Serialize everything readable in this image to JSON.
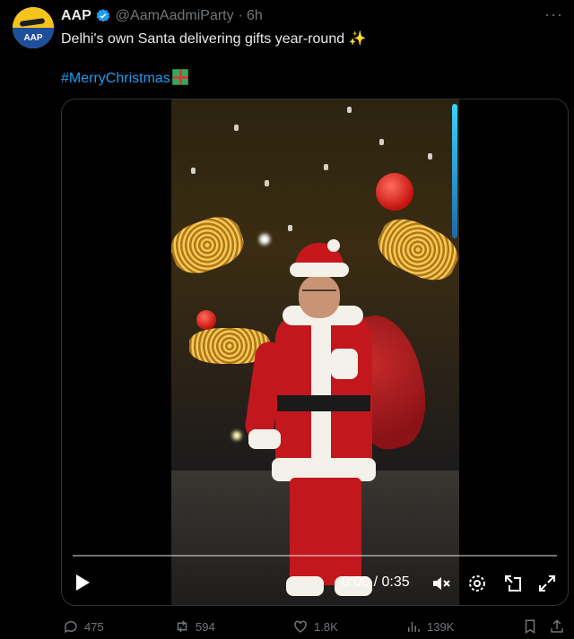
{
  "post": {
    "author_name": "AAP",
    "handle": "@AamAadmiParty",
    "separator": "·",
    "time": "6h",
    "avatar_text": "AAP",
    "more_label": "···",
    "text": "Delhi's own Santa delivering gifts year-round",
    "text_emoji": "✨",
    "hashtag": "#MerryChristmas",
    "hashtag_emoji_icon": "gift-icon"
  },
  "video": {
    "current_time": "0:00",
    "duration": "0:35",
    "time_separator": "/",
    "progress": 0,
    "icons": [
      "play-icon",
      "mute-icon",
      "settings-icon",
      "popout-icon",
      "fullscreen-icon"
    ]
  },
  "actions": {
    "replies": "475",
    "reposts": "594",
    "likes": "1.8K",
    "views": "139K",
    "icons": [
      "reply-icon",
      "repost-icon",
      "like-icon",
      "views-icon",
      "bookmark-icon",
      "share-icon"
    ]
  },
  "colors": {
    "background": "#000000",
    "text": "#e7e9ea",
    "secondary": "#71767b",
    "accent": "#1d9bf0",
    "verified": "#1d9bf0"
  }
}
